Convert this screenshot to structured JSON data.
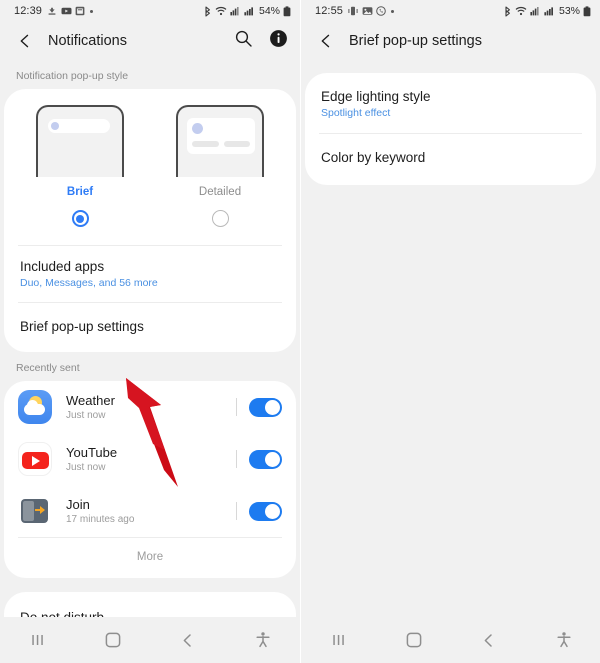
{
  "left_screen": {
    "status_bar": {
      "clock": "12:39",
      "left_icons": [
        "download-icon",
        "youtube-icon",
        "screenshot-icon",
        "dot-icon"
      ],
      "right_icons": [
        "bluetooth-icon",
        "wifi-icon",
        "signal-icon",
        "cellular-icon"
      ],
      "battery": "54%"
    },
    "app_bar": {
      "back": "back-arrow-icon",
      "title": "Notifications",
      "actions": [
        "search-icon",
        "info-icon"
      ]
    },
    "popup_style": {
      "section_label": "Notification pop-up style",
      "options": [
        {
          "label": "Brief",
          "selected": true
        },
        {
          "label": "Detailed",
          "selected": false
        }
      ]
    },
    "rows": [
      {
        "title": "Included apps",
        "subtitle": "Duo, Messages, and 56 more",
        "subtitle_color": "blue"
      },
      {
        "title": "Brief pop-up settings",
        "subtitle": "",
        "subtitle_color": "none"
      }
    ],
    "recently_sent": {
      "section_label": "Recently sent",
      "apps": [
        {
          "name": "Weather",
          "time": "Just now",
          "icon": "weather-icon",
          "toggle": "on"
        },
        {
          "name": "YouTube",
          "time": "Just now",
          "icon": "youtube-icon",
          "toggle": "on"
        },
        {
          "name": "Join",
          "time": "17 minutes ago",
          "icon": "join-icon",
          "toggle": "on"
        }
      ],
      "more_label": "More"
    },
    "dnd_row": {
      "title": "Do not disturb"
    },
    "nav_bar": [
      "recents-icon",
      "home-icon",
      "back-icon",
      "accessibility-icon"
    ]
  },
  "right_screen": {
    "status_bar": {
      "clock": "12:55",
      "left_icons": [
        "vibrate-icon",
        "gallery-icon",
        "whatsapp-icon",
        "dot-icon"
      ],
      "right_icons": [
        "bluetooth-icon",
        "wifi-icon",
        "signal-icon",
        "cellular-icon"
      ],
      "battery": "53%"
    },
    "app_bar": {
      "back": "back-arrow-icon",
      "title": "Brief pop-up settings",
      "actions": []
    },
    "rows": [
      {
        "title": "Edge lighting style",
        "subtitle": "Spotlight effect",
        "subtitle_color": "blue"
      },
      {
        "title": "Color by keyword",
        "subtitle": "",
        "subtitle_color": "none"
      }
    ],
    "nav_bar": [
      "recents-icon",
      "home-icon",
      "back-icon",
      "accessibility-icon"
    ]
  },
  "annotation": {
    "arrow_color": "#cc0b16",
    "points_to": "Brief pop-up settings"
  },
  "colors": {
    "accent_blue": "#2f7cf6",
    "toggle_blue": "#1d7bf0",
    "link_blue": "#4a90e2",
    "background": "#f1f1f1",
    "card": "#ffffff",
    "text_primary": "#1d1d1d",
    "text_secondary": "#9c9c9c"
  }
}
